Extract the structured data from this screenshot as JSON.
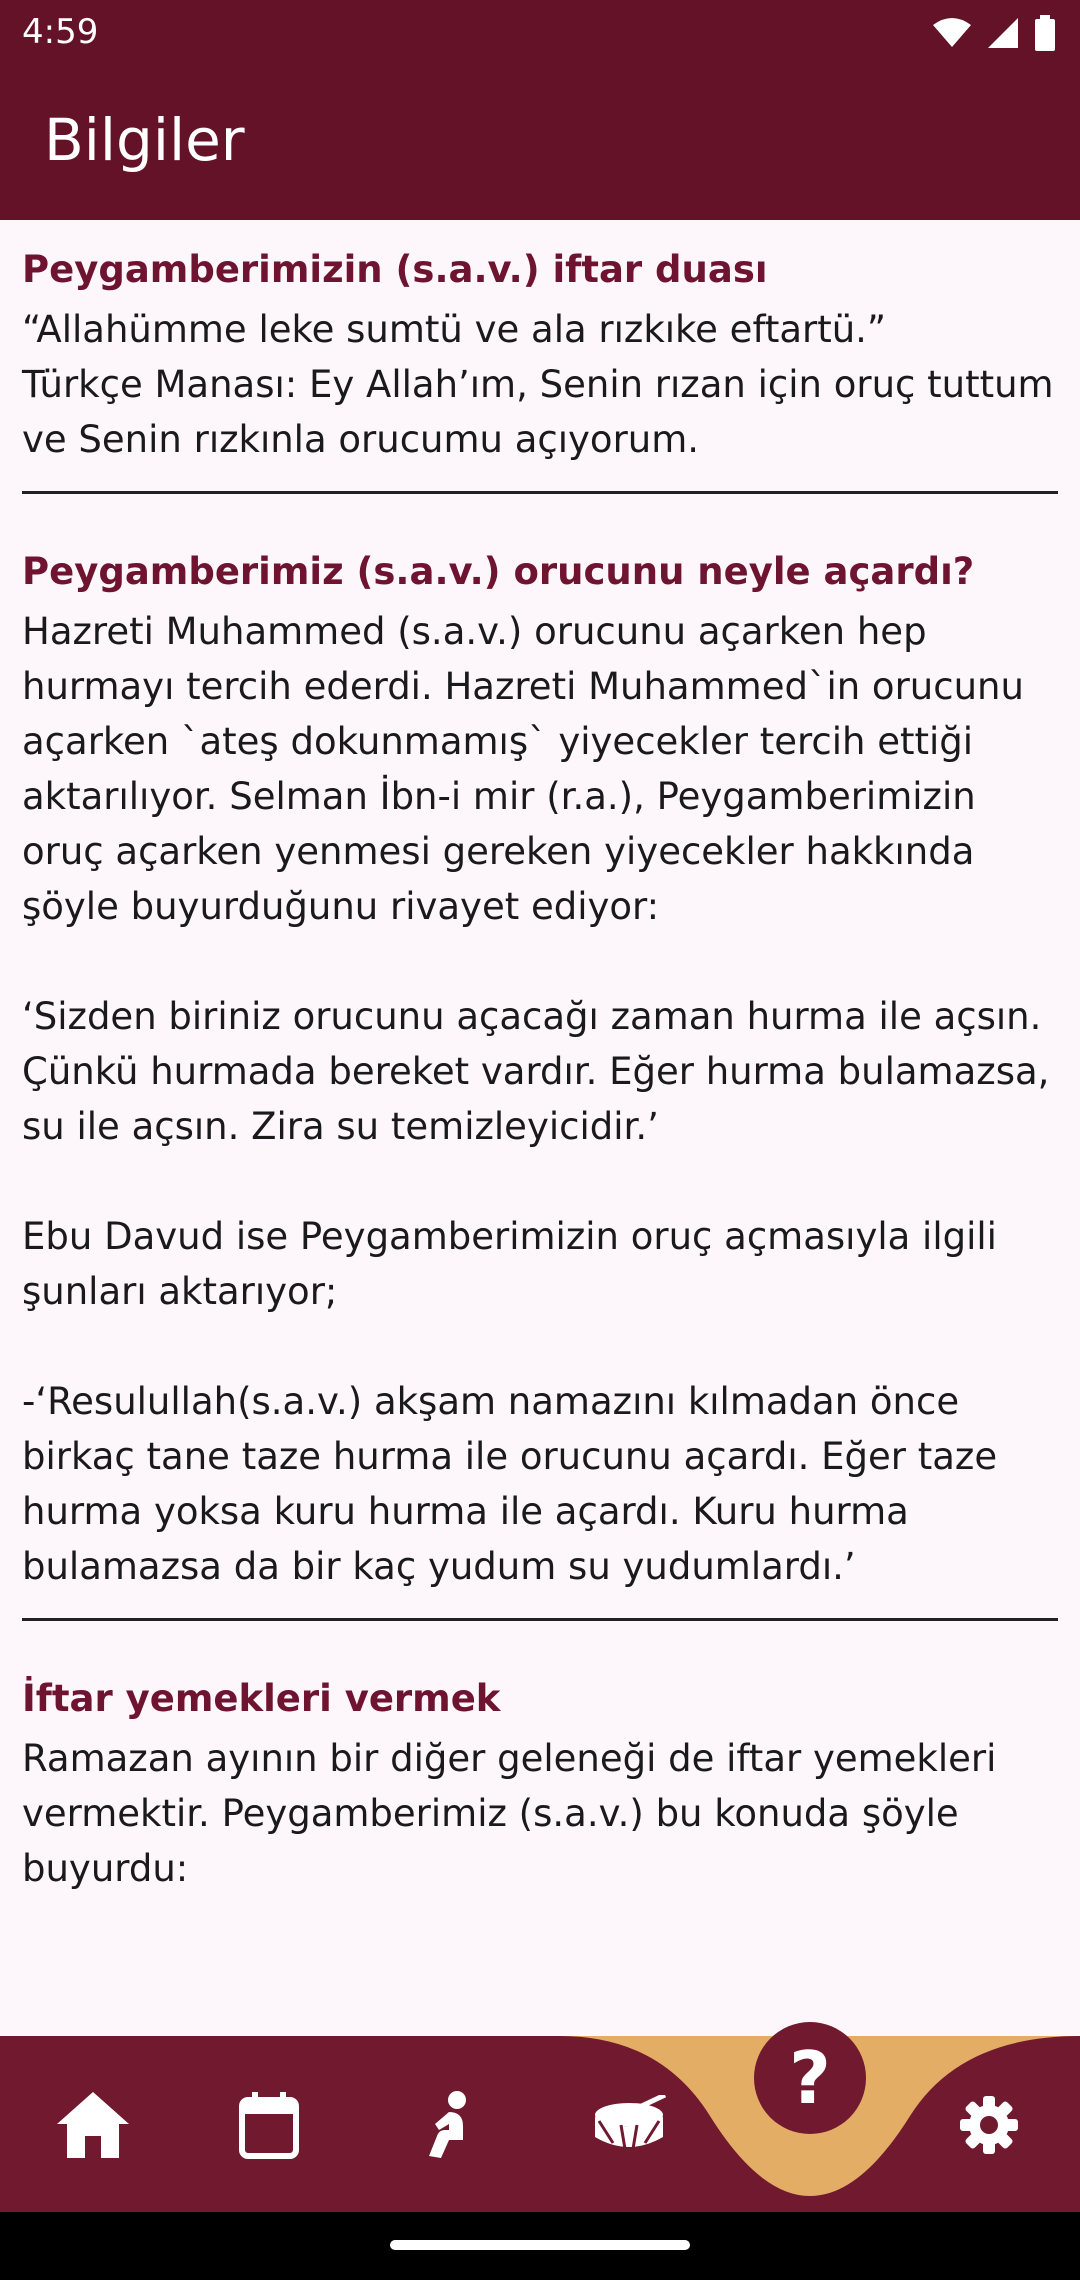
{
  "status_bar": {
    "time": "4:59",
    "icons": [
      "wifi-icon",
      "signal-icon",
      "battery-icon"
    ]
  },
  "app_bar": {
    "title": "Bilgiler"
  },
  "sections": [
    {
      "title": "Peygamberimizin (s.a.v.) iftar duası",
      "body": "“Allahümme leke sumtü ve ala rızkıke eftartü.”\nTürkçe Manası: Ey Allah’ım, Senin rızan için oruç tuttum ve Senin rızkınla orucumu açıyorum."
    },
    {
      "title": "Peygamberimiz (s.a.v.) orucunu neyle açardı?",
      "body": "Hazreti Muhammed (s.a.v.) orucunu açarken hep hurmayı tercih ederdi. Hazreti Muhammed`in orucunu açarken `ateş dokunmamış` yiyecekler tercih ettiği aktarılıyor. Selman İbn-i mir (r.a.), Peygamberimizin oruç açarken yenmesi gereken yiyecekler hakkında şöyle buyurduğunu rivayet ediyor:\n\n‘Sizden biriniz orucunu açacağı zaman hurma ile açsın. Çünkü hurmada bereket vardır. Eğer hurma bulamazsa, su ile açsın. Zira su temizleyicidir.’\n\nEbu Davud ise Peygamberimizin oruç açmasıyla ilgili şunları aktarıyor;\n\n-‘Resulullah(s.a.v.) akşam namazını kılmadan önce birkaç tane taze hurma ile orucunu açardı. Eğer taze hurma yoksa kuru hurma ile açardı. Kuru hurma bulamazsa da bir kaç yudum su yudumlardı.’"
    },
    {
      "title": "İftar yemekleri vermek",
      "body": "Ramazan ayının bir diğer geleneği de iftar yemekleri vermektir. Peygamberimiz (s.a.v.) bu konuda şöyle buyurdu:"
    }
  ],
  "bottom_nav": {
    "items": [
      {
        "icon": "home-icon"
      },
      {
        "icon": "calendar-icon"
      },
      {
        "icon": "prayer-icon"
      },
      {
        "icon": "drum-icon"
      },
      {
        "icon": "help-icon",
        "label": "?",
        "selected": true
      },
      {
        "icon": "settings-icon"
      }
    ],
    "accent_color": "#e3ad66",
    "background_color": "#70192f"
  },
  "colors": {
    "app_bar": "#631227",
    "section_title": "#6e1430",
    "background": "#fdf6fa"
  }
}
